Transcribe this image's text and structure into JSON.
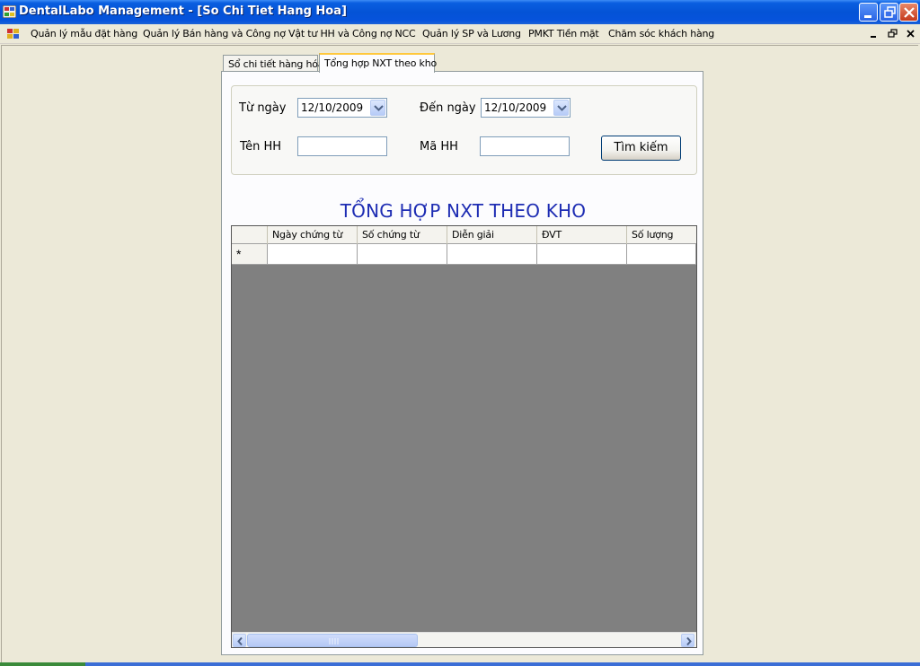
{
  "window": {
    "title": "DentalLabo Management - [So Chi Tiet Hang Hoa]"
  },
  "menu": {
    "items": [
      {
        "label": "Quản lý mẫu đặt hàng"
      },
      {
        "label": "Quản lý Bán hàng và Công nợ"
      },
      {
        "label": "Vật tư HH và Công nợ NCC"
      },
      {
        "label": "Quản lý SP và Lương"
      },
      {
        "label": "PMKT Tiền mặt"
      },
      {
        "label": "Chăm sóc khách hàng"
      }
    ]
  },
  "tabs": [
    {
      "label": "Sổ chi tiết hàng hóa",
      "active": false
    },
    {
      "label": "Tổng hợp NXT theo kho",
      "active": true
    }
  ],
  "filters": {
    "from_label": "Từ ngày",
    "from_value": "12/10/2009",
    "to_label": "Đến ngày",
    "to_value": "12/10/2009",
    "name_label": "Tên HH",
    "name_value": "",
    "code_label": "Mã HH",
    "code_value": "",
    "search_button": "Tìm kiếm"
  },
  "grid": {
    "title": "TỔNG HỢP NXT THEO KHO",
    "columns": [
      "Ngày chứng từ",
      "Số chứng từ",
      "Diễn giải",
      "ĐVT",
      "Số lượng"
    ],
    "new_row_marker": "*"
  },
  "colors": {
    "titlebar": "#0453d6",
    "grid_title": "#1d2cb3",
    "grid_background": "#808080",
    "active_tab_accent": "#ffc83c"
  }
}
